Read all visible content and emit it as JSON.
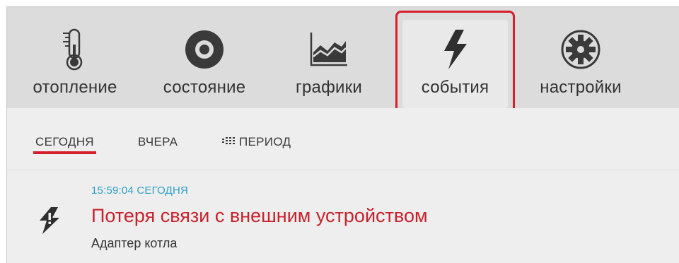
{
  "nav": {
    "items": [
      {
        "label": "отопление",
        "icon": "thermometer-icon"
      },
      {
        "label": "состояние",
        "icon": "status-target-icon"
      },
      {
        "label": "графики",
        "icon": "chart-icon"
      },
      {
        "label": "события",
        "icon": "lightning-icon",
        "active": true
      },
      {
        "label": "настройки",
        "icon": "gear-icon"
      }
    ]
  },
  "tabs": {
    "today": "СЕГОДНЯ",
    "yesterday": "ВЧЕРА",
    "period": "ПЕРИОД",
    "active": "today"
  },
  "events": [
    {
      "time": "15:59:04 СЕГОДНЯ",
      "title": "Потеря связи с внешним устройством",
      "subtitle": "Адаптер котла",
      "icon": "lightning-warning-icon"
    }
  ],
  "colors": {
    "accent_red": "#d4202a",
    "time_blue": "#2e9fc9",
    "nav_bg": "#dcdcdc",
    "content_bg": "#eeeeee"
  }
}
